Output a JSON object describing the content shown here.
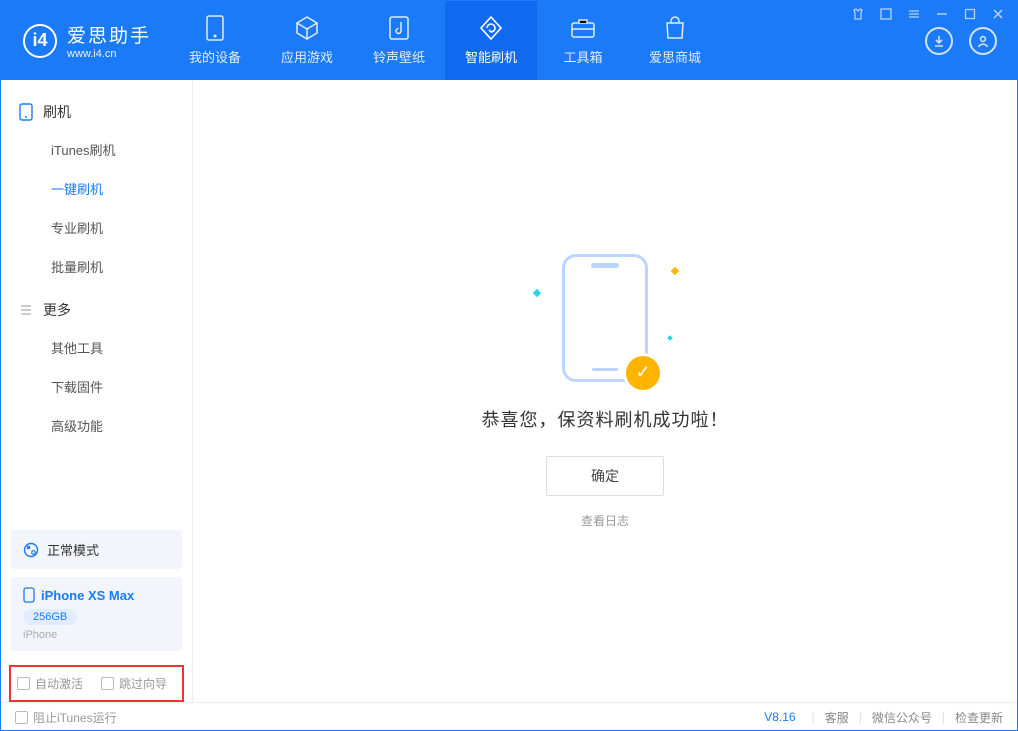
{
  "brand": {
    "name": "爱思助手",
    "url": "www.i4.cn"
  },
  "tabs": [
    {
      "label": "我的设备",
      "icon": "phone-icon"
    },
    {
      "label": "应用游戏",
      "icon": "cube-icon"
    },
    {
      "label": "铃声壁纸",
      "icon": "music-icon"
    },
    {
      "label": "智能刷机",
      "icon": "refresh-icon"
    },
    {
      "label": "工具箱",
      "icon": "toolbox-icon"
    },
    {
      "label": "爱思商城",
      "icon": "bag-icon"
    }
  ],
  "sidebar": {
    "group1": "刷机",
    "items1": [
      "iTunes刷机",
      "一键刷机",
      "专业刷机",
      "批量刷机"
    ],
    "group2": "更多",
    "items2": [
      "其他工具",
      "下载固件",
      "高级功能"
    ]
  },
  "mode": {
    "label": "正常模式"
  },
  "device": {
    "name": "iPhone XS Max",
    "capacity": "256GB",
    "type": "iPhone"
  },
  "checks": {
    "auto_activate": "自动激活",
    "skip_guide": "跳过向导"
  },
  "main": {
    "success_msg": "恭喜您，保资料刷机成功啦！",
    "ok": "确定",
    "view_log": "查看日志"
  },
  "footer": {
    "block_itunes": "阻止iTunes运行",
    "version": "V8.16",
    "links": [
      "客服",
      "微信公众号",
      "检查更新"
    ]
  }
}
